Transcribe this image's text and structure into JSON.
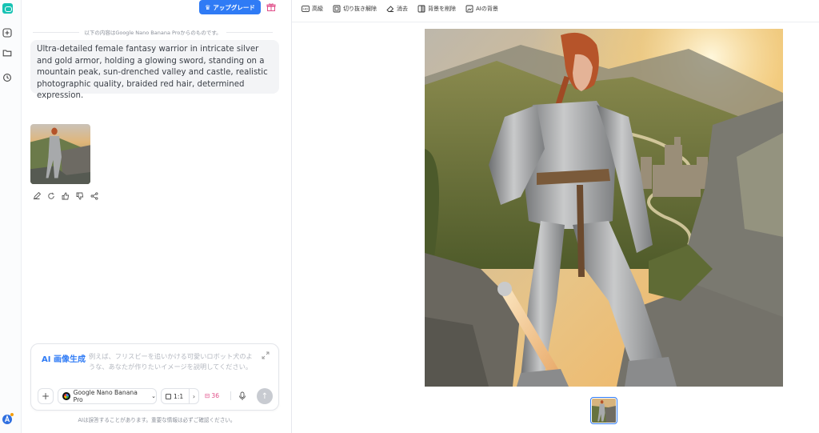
{
  "header": {
    "upgrade_label": "アップグレード"
  },
  "chat": {
    "notice": "以下の内容はGoogle Nano Banana Proからのものです。",
    "prompt": "Ultra-detailed female fantasy warrior in intricate silver and gold armor, holding a glowing sword, standing on a mountain peak, sun-drenched valley and castle, realistic photographic quality, braided red hair, determined expression."
  },
  "composer": {
    "mode_label": "AI 画像生成",
    "placeholder": "例えば、フリスビーを追いかける可愛いロボット犬のような、あなたが作りたいイメージを説明してください。",
    "model": "Google Nano Banana Pro",
    "ratio": "1:1",
    "credits": "36",
    "disclaimer": "AIは誤答することがあります。重要な情報は必ずご確認ください。"
  },
  "toolbar": {
    "items": [
      "高級",
      "切り抜き解除",
      "消去",
      "背景を削除",
      "AIの背景"
    ]
  },
  "colors": {
    "accent": "#2f7bf5",
    "credits": "#e0508a",
    "logo": "#16c2b3"
  }
}
